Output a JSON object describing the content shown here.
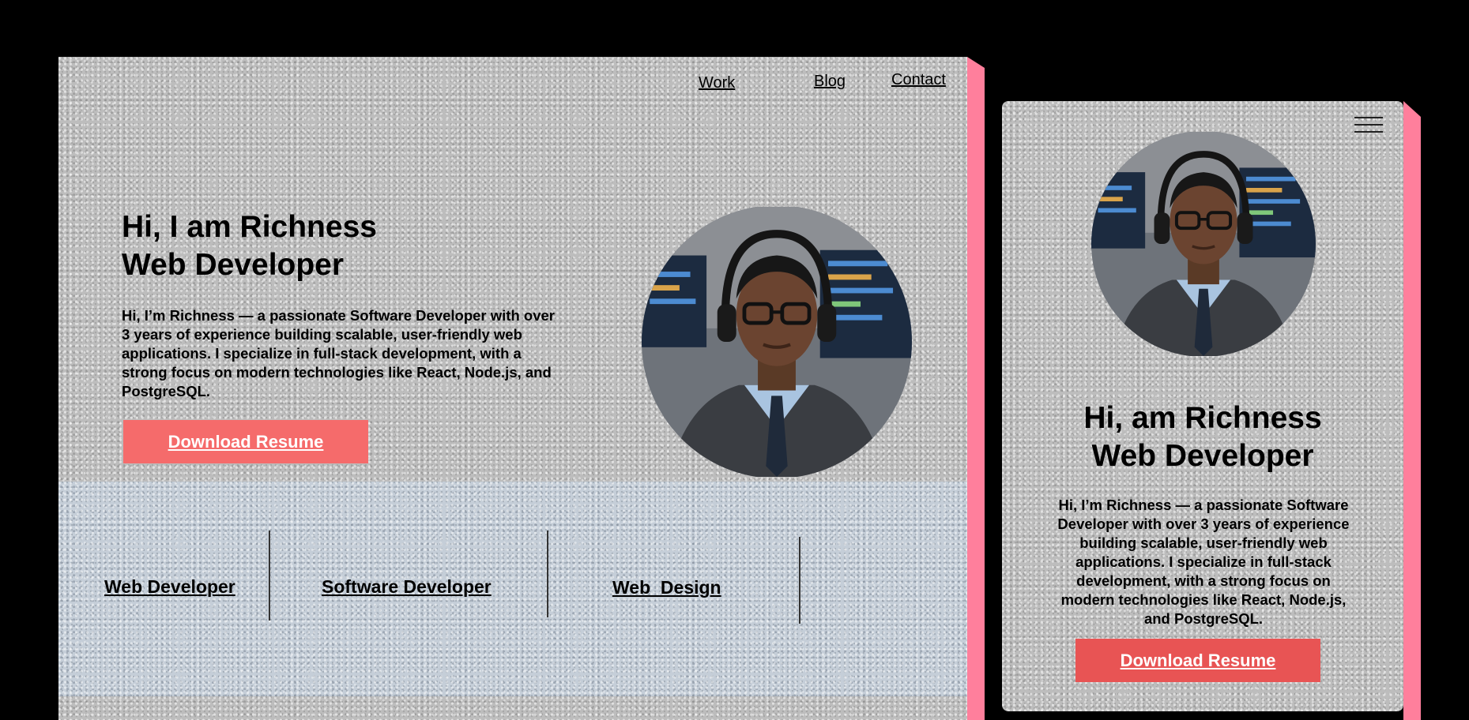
{
  "desktop": {
    "nav": {
      "work": "Work",
      "blog": "Blog",
      "contact": "Contact"
    },
    "hero": {
      "title_line1": "Hi, I am Richness",
      "title_line2": "Web Developer",
      "description": "Hi, I’m Richness — a passionate Software Developer with over 3 years of experience building scalable, user-friendly web applications. I specialize in full-stack development, with a strong focus on modern technologies like React, Node.js, and PostgreSQL.",
      "resume_label": "Download Resume"
    },
    "skills": [
      "Web Developer",
      "Software Developer",
      "Web  Design"
    ]
  },
  "mobile": {
    "title_line1": "Hi, am Richness",
    "title_line2": "Web Developer",
    "description": "Hi, I’m Richness — a passionate Software Developer with over 3 years of experience building scalable, user-friendly web applications. I specialize in full-stack development, with a strong focus on modern technologies like React, Node.js, and PostgreSQL.",
    "resume_label": "Download Resume"
  },
  "colors": {
    "accent": "#f56b6b",
    "frame_shadow": "#ff7f9c",
    "band": "#c5ced8",
    "background": "#000000"
  }
}
